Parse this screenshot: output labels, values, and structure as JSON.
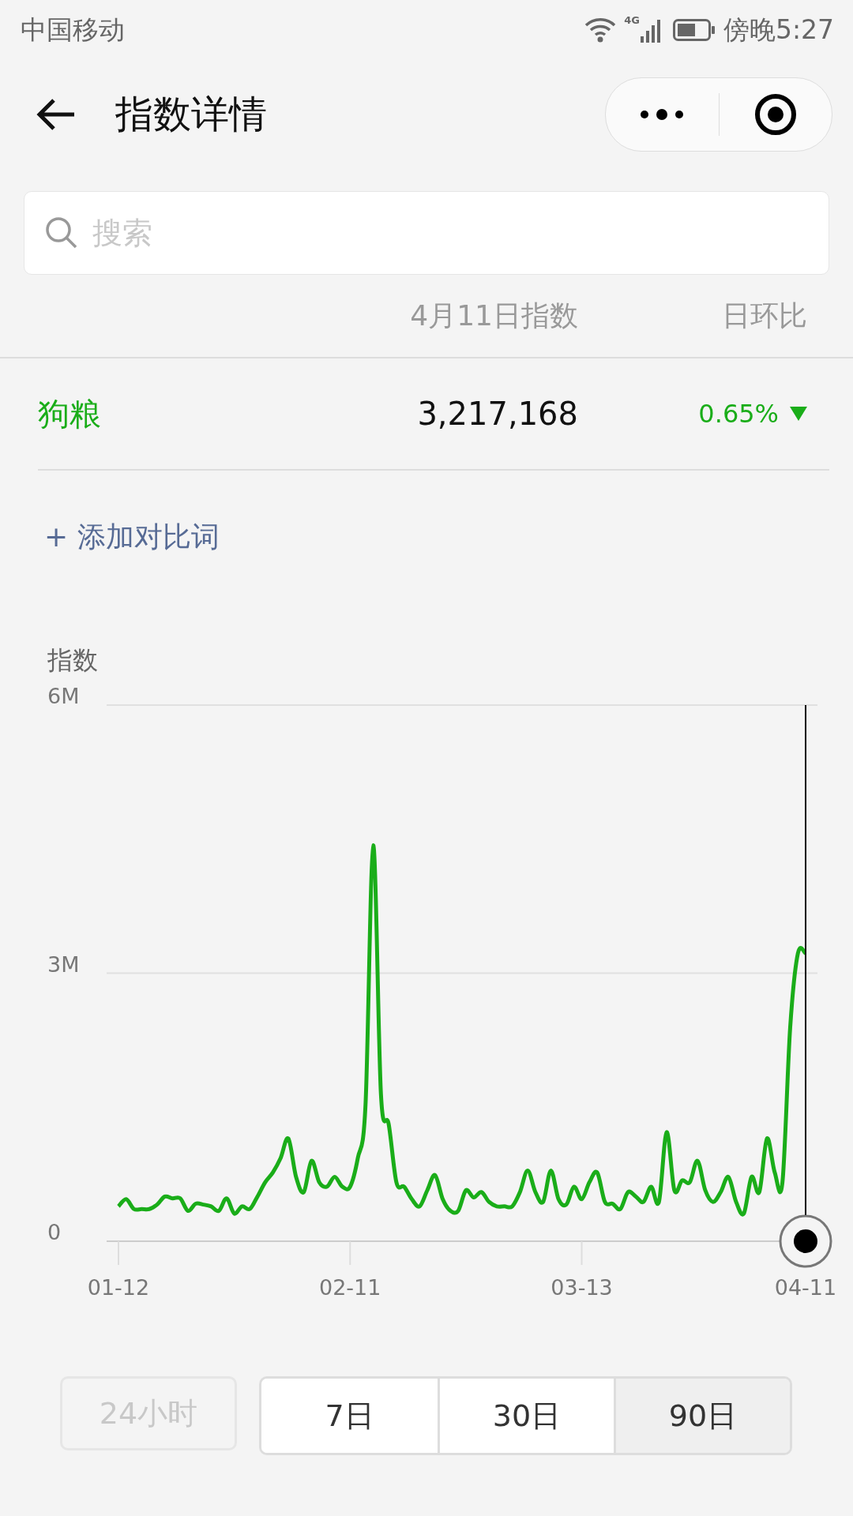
{
  "status_bar": {
    "carrier": "中国移动",
    "network": "4G",
    "time": "傍晚5:27"
  },
  "header": {
    "title": "指数详情"
  },
  "search": {
    "placeholder": "搜索"
  },
  "table": {
    "columns": [
      "4月11日指数",
      "日环比"
    ],
    "rows": [
      {
        "keyword": "狗粮",
        "index": "3,217,168",
        "change": "0.65%",
        "decrease": true
      }
    ]
  },
  "add_link": "+ 添加对比词",
  "chart": {
    "chart_data": {
      "type": "line",
      "ylabel": "指数",
      "ylim": [
        0,
        6
      ],
      "categories": [
        "01-12",
        null,
        null,
        null,
        null,
        null,
        null,
        null,
        null,
        null,
        null,
        null,
        null,
        null,
        null,
        null,
        null,
        null,
        null,
        null,
        null,
        null,
        null,
        null,
        null,
        null,
        null,
        null,
        null,
        null,
        "02-11",
        null,
        null,
        null,
        null,
        null,
        null,
        null,
        null,
        null,
        null,
        null,
        null,
        null,
        null,
        null,
        null,
        null,
        null,
        null,
        null,
        null,
        null,
        null,
        null,
        null,
        null,
        null,
        null,
        null,
        "03-13",
        null,
        null,
        null,
        null,
        null,
        null,
        null,
        null,
        null,
        null,
        null,
        null,
        null,
        null,
        null,
        null,
        null,
        null,
        null,
        null,
        null,
        null,
        null,
        null,
        null,
        null,
        null,
        null,
        "04-11"
      ],
      "ref_lines": [
        {
          "axis": "y",
          "value": 3
        }
      ],
      "yticks": [
        {
          "value": 0,
          "label": "0"
        },
        {
          "value": 3,
          "label": "3M"
        },
        {
          "value": 6,
          "label": "6M"
        }
      ],
      "series": [
        {
          "color": "#1aad19",
          "values": [
            0.39,
            0.47,
            0.36,
            0.36,
            0.36,
            0.41,
            0.5,
            0.48,
            0.48,
            0.34,
            0.42,
            0.41,
            0.39,
            0.34,
            0.48,
            0.31,
            0.39,
            0.36,
            0.5,
            0.66,
            0.77,
            0.93,
            1.15,
            0.72,
            0.55,
            0.9,
            0.66,
            0.61,
            0.72,
            0.61,
            0.61,
            0.93,
            1.53,
            4.43,
            1.64,
            1.31,
            0.66,
            0.61,
            0.47,
            0.39,
            0.57,
            0.74,
            0.47,
            0.34,
            0.34,
            0.57,
            0.49,
            0.55,
            0.44,
            0.39,
            0.39,
            0.39,
            0.55,
            0.79,
            0.55,
            0.44,
            0.79,
            0.47,
            0.41,
            0.61,
            0.47,
            0.66,
            0.77,
            0.44,
            0.42,
            0.36,
            0.55,
            0.5,
            0.44,
            0.61,
            0.44,
            1.22,
            0.57,
            0.68,
            0.66,
            0.9,
            0.57,
            0.44,
            0.55,
            0.72,
            0.44,
            0.31,
            0.72,
            0.55,
            1.15,
            0.77,
            0.66,
            2.39,
            3.22,
            3.22
          ]
        }
      ]
    }
  },
  "ranges": [
    {
      "label": "24小时",
      "selected": false,
      "disabled": true
    },
    {
      "label": "7日",
      "selected": false,
      "disabled": false
    },
    {
      "label": "30日",
      "selected": false,
      "disabled": false
    },
    {
      "label": "90日",
      "selected": true,
      "disabled": false
    }
  ]
}
